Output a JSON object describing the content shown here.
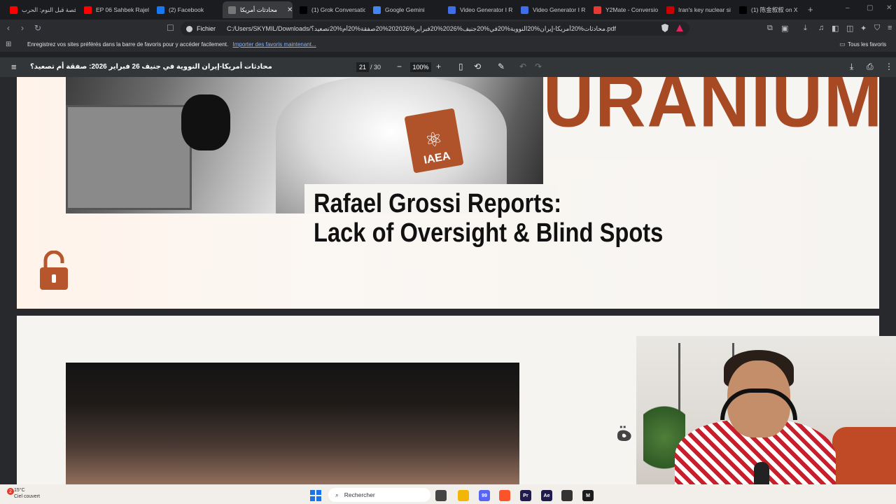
{
  "tabs": [
    {
      "label": "قصة قبل النوم: الحرب",
      "favicon": "youtube-icon",
      "color": "#ff0000"
    },
    {
      "label": "EP 06 Sahbek Rajel",
      "favicon": "youtube-icon",
      "color": "#ff0000"
    },
    {
      "label": "(2) Facebook",
      "favicon": "facebook-icon",
      "color": "#1877f2"
    },
    {
      "label": "محادثات أمريكا",
      "favicon": "pdf-icon",
      "color": "#777777",
      "active": true
    },
    {
      "label": "(1) Grok Conversatio",
      "favicon": "x-icon",
      "color": "#000000"
    },
    {
      "label": "Google Gemini",
      "favicon": "gemini-icon",
      "color": "#4285f4"
    },
    {
      "label": "Video Generator I R",
      "favicon": "doc-icon",
      "color": "#3f6ee8"
    },
    {
      "label": "Video Generator I R",
      "favicon": "doc-icon",
      "color": "#3f6ee8"
    },
    {
      "label": "Y2Mate - Conversio",
      "favicon": "y2mate-icon",
      "color": "#e53935"
    },
    {
      "label": "Iran's key nuclear si",
      "favicon": "reuters-icon",
      "color": "#cc0000"
    },
    {
      "label": "(1) 陈金叙叙 on X",
      "favicon": "x-icon",
      "color": "#000000"
    }
  ],
  "new_tab": "+",
  "window_controls": [
    "–",
    "▢",
    "✕"
  ],
  "address_bar": {
    "scheme_label": "Fichier",
    "url": "C:/Users/SKYMIL/Downloads/محادثات%20أمريكا-إيران%20النووية%20في%20جنيف%2026%20فبراير%202026%20صفقة%20أم%20تصعيد؟.pdf"
  },
  "favorites_bar": {
    "message": "Enregistrez vos sites préférés dans la barre de favoris pour y accéder facilement.",
    "import_link": "Importer des favoris maintenant...",
    "all_favorites": "Tous les favoris"
  },
  "pdf_toolbar": {
    "title": "محادثات أمريكا-إيران النووية في جنيف 26 فبراير 2026: صفقة أم تصعيد؟",
    "current_page": "21",
    "total_pages": "/ 30",
    "zoom": "100%"
  },
  "page_content": {
    "heading_word": "URANIUM",
    "badge": "IAEA",
    "headline_line1": "Rafael Grossi Reports:",
    "headline_line2": "Lack of Oversight & Blind Spots",
    "partial_char": "ة",
    "accent_color": "#a74a24"
  },
  "taskbar": {
    "weather_temp": "15°C",
    "weather_desc": "Ciel couvert",
    "weather_badge": "2",
    "search_placeholder": "Rechercher",
    "apps": [
      {
        "name": "file-explorer-icon",
        "label": "",
        "color": "#f2b705"
      },
      {
        "name": "discord-icon",
        "label": "99",
        "color": "#5865f2"
      },
      {
        "name": "brave-icon",
        "label": "",
        "color": "#fb542b"
      },
      {
        "name": "premiere-icon",
        "label": "Pr",
        "color": "#1f1b4d"
      },
      {
        "name": "after-effects-icon",
        "label": "Ae",
        "color": "#1f1b4d"
      },
      {
        "name": "davinci-icon",
        "label": "",
        "color": "#333333"
      },
      {
        "name": "m-app-icon",
        "label": "M",
        "color": "#1c1c1c"
      }
    ]
  }
}
